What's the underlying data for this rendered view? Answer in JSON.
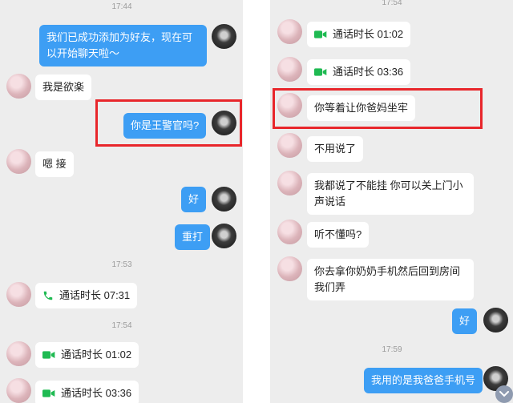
{
  "left": {
    "t1": "17:44",
    "m1": "我们已成功添加为好友，现在可以开始聊天啦～",
    "m2": "我是欲楽",
    "m3": "你是王警官吗?",
    "m4": "嗯 接",
    "m5": "好",
    "m6": "重打",
    "t2": "17:53",
    "c1": "通话时长 07:31",
    "t3": "17:54",
    "c2": "通话时长 01:02",
    "c3": "通话时长 03:36"
  },
  "right": {
    "t1": "17:54",
    "c1": "通话时长 01:02",
    "c2": "通话时长 03:36",
    "m1": "你等着让你爸妈坐牢",
    "m2": "不用说了",
    "m3": "我都说了不能挂 你可以关上门小声说话",
    "m4": "听不懂吗?",
    "m5": "你去拿你奶奶手机然后回到房间我们弄",
    "m6": "好",
    "t2": "17:59",
    "m7": "我用的是我爸爸手机号"
  },
  "colors": {
    "outgoing_bubble": "#3d9ef4",
    "highlight_box": "#e8262b",
    "call_icon_green": "#1fba52"
  },
  "icons": {
    "voice_call": "phone-icon",
    "video_call": "video-camera-icon",
    "scroll": "chevron-down-icon"
  }
}
